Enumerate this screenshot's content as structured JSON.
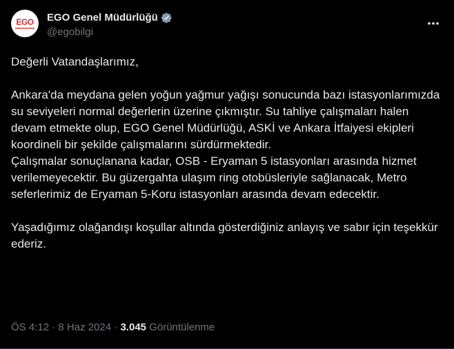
{
  "account": {
    "display_name": "EGO Genel Müdürlüğü",
    "handle": "@egobilgi",
    "avatar_text": "EGO",
    "verified_color": "#829aab"
  },
  "tweet": {
    "paragraphs": [
      "Değerli Vatandaşlarımız,",
      "Ankara'da meydana gelen yoğun yağmur yağışı sonucunda bazı istasyonlarımızda su seviyeleri normal değerlerin üzerine çıkmıştır. Su tahliye çalışmaları halen devam etmekte olup, EGO Genel Müdürlüğü, ASKİ ve Ankara İtfaiyesi ekipleri koordineli bir şekilde çalışmalarını sürdürmektedir.\nÇalışmalar sonuçlanana kadar, OSB - Eryaman 5 istasyonları arasında hizmet verilemeyecektir. Bu güzergahta ulaşım ring otobüsleriyle sağlanacak, Metro seferlerimiz de Eryaman 5-Koru istasyonları arasında devam edecektir.",
      "Yaşadığımız olağandışı koşullar altında gösterdiğiniz anlayış ve sabır için teşekkür ederiz."
    ]
  },
  "meta": {
    "time": "ÖS 4:12",
    "separator": " · ",
    "date": "8 Haz 2024",
    "views_count": "3.045",
    "views_label": " Görüntülenme"
  },
  "icons": {
    "verified": "verified-badge-icon",
    "more": "more-options-icon"
  }
}
